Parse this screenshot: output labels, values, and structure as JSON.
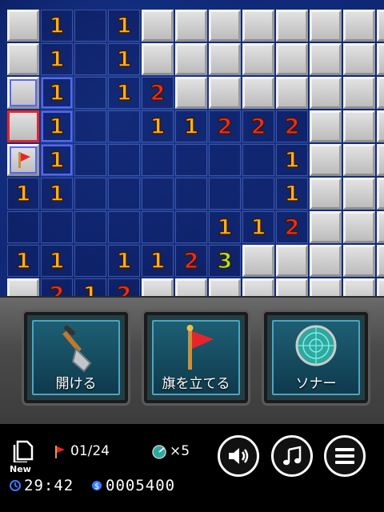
{
  "board": {
    "rows": [
      [
        "c",
        "1",
        "o",
        "1",
        "c",
        "c",
        "c",
        "c",
        "c",
        "c",
        "c",
        "c"
      ],
      [
        "c",
        "1",
        "o",
        "1",
        "c",
        "c",
        "c",
        "c",
        "c",
        "c",
        "c",
        "c"
      ],
      [
        "c",
        "1",
        "o",
        "1",
        "2",
        "c",
        "c",
        "c",
        "c",
        "c",
        "c",
        "c"
      ],
      [
        "c",
        "1",
        "o",
        "o",
        "1",
        "1",
        "2",
        "2",
        "2",
        "c",
        "c",
        "c"
      ],
      [
        "f",
        "1",
        "o",
        "o",
        "o",
        "o",
        "o",
        "o",
        "1",
        "c",
        "c",
        "c"
      ],
      [
        "1",
        "1",
        "o",
        "o",
        "o",
        "o",
        "o",
        "o",
        "1",
        "c",
        "c",
        "c"
      ],
      [
        "o",
        "o",
        "o",
        "o",
        "o",
        "o",
        "1",
        "1",
        "2",
        "c",
        "c",
        "c"
      ],
      [
        "1",
        "1",
        "o",
        "1",
        "1",
        "2",
        "3",
        "c",
        "c",
        "c",
        "c",
        "c"
      ],
      [
        "c",
        "2",
        "1",
        "2",
        "c",
        "c",
        "c",
        "c",
        "c",
        "c",
        "c",
        "c"
      ]
    ],
    "selected": [
      3,
      0
    ],
    "highlighted": [
      [
        2,
        0
      ],
      [
        2,
        1
      ],
      [
        3,
        1
      ],
      [
        4,
        0
      ],
      [
        4,
        1
      ]
    ]
  },
  "actions": {
    "dig_label": "開ける",
    "flag_label": "旗を立てる",
    "sonar_label": "ソナー"
  },
  "status": {
    "new_label": "New",
    "flags": "01/24",
    "sonar_count": "×5",
    "time": "29:42",
    "score": "0005400"
  },
  "colors": {
    "number_1": "#ffb020",
    "number_2": "#ef2a2a",
    "number_3": "#a6e630",
    "selection": "#e8242a"
  }
}
